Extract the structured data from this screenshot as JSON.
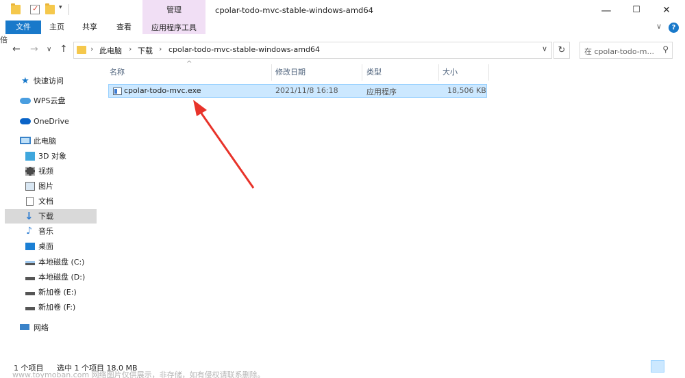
{
  "window": {
    "title": "cpolar-todo-mvc-stable-windows-amd64",
    "context_tab": "管理",
    "minimize": "—",
    "maximize": "☐",
    "close": "✕"
  },
  "ribbon": {
    "tabs": [
      "文件",
      "主页",
      "共享",
      "查看"
    ],
    "tools_tab": "应用程序工具",
    "expand": "∨",
    "help": "?"
  },
  "cut_text": "倍",
  "address": {
    "parts": [
      "此电脑",
      "下载",
      "cpolar-todo-mvc-stable-windows-amd64"
    ],
    "search_placeholder": "在 cpolar-todo-m..."
  },
  "nav": {
    "items": [
      {
        "label": "快速访问",
        "icon": "star-icon"
      },
      {
        "label": "WPS云盘",
        "icon": "cloud-icon"
      },
      {
        "label": "OneDrive",
        "icon": "onedrive-icon"
      },
      {
        "label": "此电脑",
        "icon": "computer-icon"
      },
      {
        "label": "3D 对象",
        "icon": "cube-icon"
      },
      {
        "label": "视频",
        "icon": "video-icon"
      },
      {
        "label": "图片",
        "icon": "picture-icon"
      },
      {
        "label": "文档",
        "icon": "document-icon"
      },
      {
        "label": "下载",
        "icon": "download-icon",
        "selected": true
      },
      {
        "label": "音乐",
        "icon": "music-icon"
      },
      {
        "label": "桌面",
        "icon": "desktop-icon"
      },
      {
        "label": "本地磁盘 (C:)",
        "icon": "drive-icon"
      },
      {
        "label": "本地磁盘 (D:)",
        "icon": "drive-icon"
      },
      {
        "label": "新加卷 (E:)",
        "icon": "drive-icon"
      },
      {
        "label": "新加卷 (F:)",
        "icon": "drive-icon"
      },
      {
        "label": "网络",
        "icon": "network-icon"
      }
    ]
  },
  "columns": [
    "名称",
    "修改日期",
    "类型",
    "大小"
  ],
  "files": [
    {
      "name": "cpolar-todo-mvc.exe",
      "modified": "2021/11/8 16:18",
      "type": "应用程序",
      "size": "18,506 KB"
    }
  ],
  "status": {
    "count": "1 个项目",
    "selected": "选中 1 个项目 18.0 MB"
  },
  "watermark": "www.toymoban.com 网络图片仅供展示，非存储，如有侵权请联系删除。",
  "colors": {
    "file_tab": "#1979ca",
    "manage_tab": "#f1dff5",
    "selection": "#cce8ff",
    "arrow": "#e8332a"
  }
}
